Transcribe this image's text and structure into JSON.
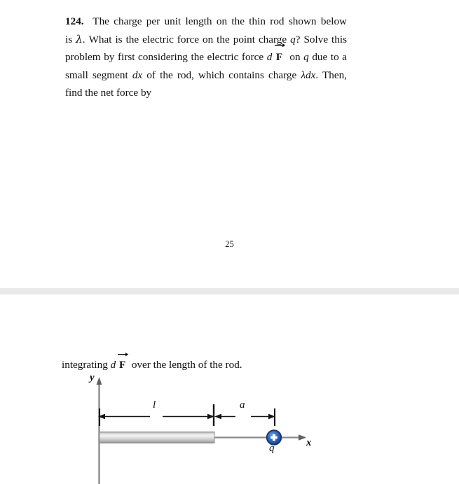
{
  "document": {
    "page_number": "25"
  },
  "problem": {
    "number": "124.",
    "line1_a": "The charge per unit length on the thin rod shown below is",
    "lambda": "λ",
    "line1_b": ". What is the electric force on the point charge",
    "q_var": "q",
    "line2": "? Solve this problem by first considering the electric force",
    "d_var": "d",
    "F_var": "F",
    "line3_a": "on",
    "line3_b": "due to a small segment",
    "dx": "dx",
    "line3_c": "of the rod, which contains charge",
    "lambda_dx": "λdx",
    "line3_d": ". Then, find the net force by"
  },
  "continuation": {
    "prefix": "integrating",
    "d_var": "d",
    "F_var": "F",
    "suffix": "over the length of the rod."
  },
  "figure": {
    "axis_y_label": "y",
    "axis_x_label": "x",
    "charge_label": "q",
    "charge_sign": "+",
    "dimension_rod_label": "l",
    "dimension_gap_label": "a",
    "colors": {
      "charge_ring": "#1c2f66",
      "charge_fill": "#2f6ec4",
      "charge_plus": "#ffffff",
      "rod_light": "#f2f2f2",
      "rod_mid": "#c9c9c9",
      "rod_dark": "#8f8f8f",
      "axis": "#8c8c8c",
      "dimension": "#151515",
      "page_gap": "#e9e9e9"
    }
  }
}
